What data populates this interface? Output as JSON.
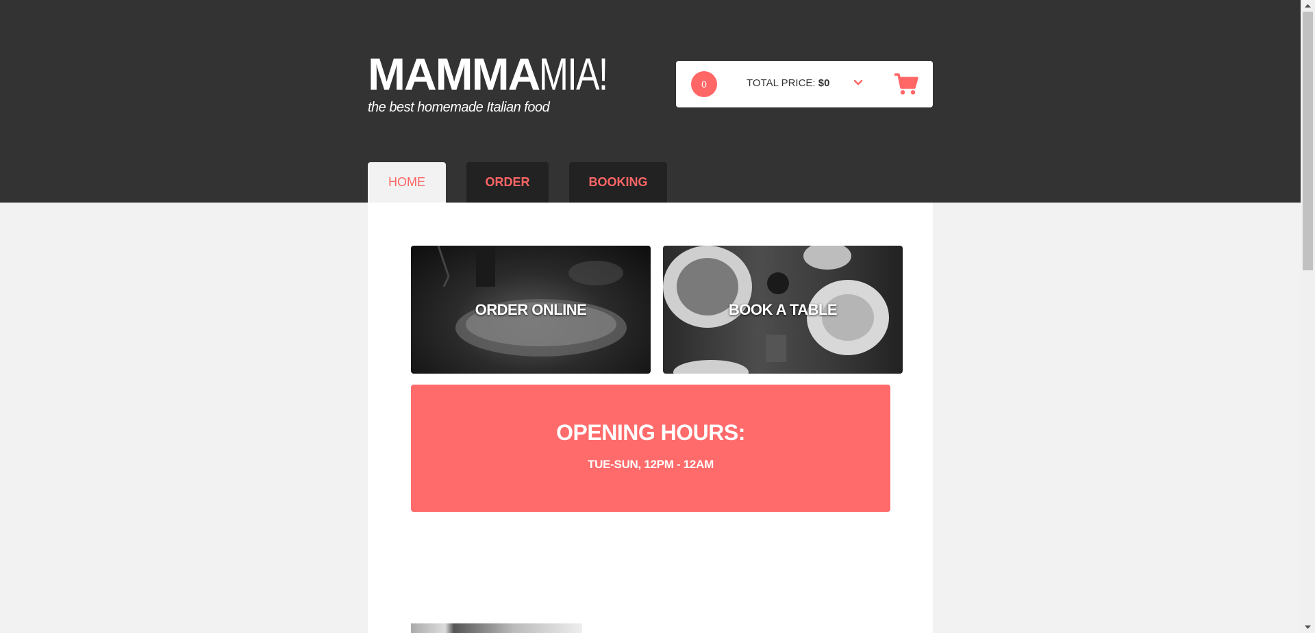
{
  "header": {
    "logo_bold": "MAMMA",
    "logo_light": "MIA!",
    "tagline": "the best homemade Italian food"
  },
  "cart": {
    "count": "0",
    "total_label": "TOTAL PRICE: ",
    "total_value": "$0",
    "chevron_icon": "chevron-down-icon",
    "cart_icon": "shopping-cart-icon"
  },
  "nav": {
    "tabs": [
      {
        "label": "HOME",
        "active": true
      },
      {
        "label": "ORDER",
        "active": false
      },
      {
        "label": "BOOKING",
        "active": false
      }
    ]
  },
  "main": {
    "tiles": [
      {
        "label": "ORDER ONLINE"
      },
      {
        "label": "BOOK A TABLE"
      }
    ],
    "hours": {
      "title": "OPENING HOURS:",
      "time": "TUE-SUN, 12PM - 12AM"
    }
  },
  "colors": {
    "accent": "#ff6666",
    "header_bg": "#333333",
    "tab_bg": "#222222",
    "page_bg": "#f2f2f2"
  }
}
